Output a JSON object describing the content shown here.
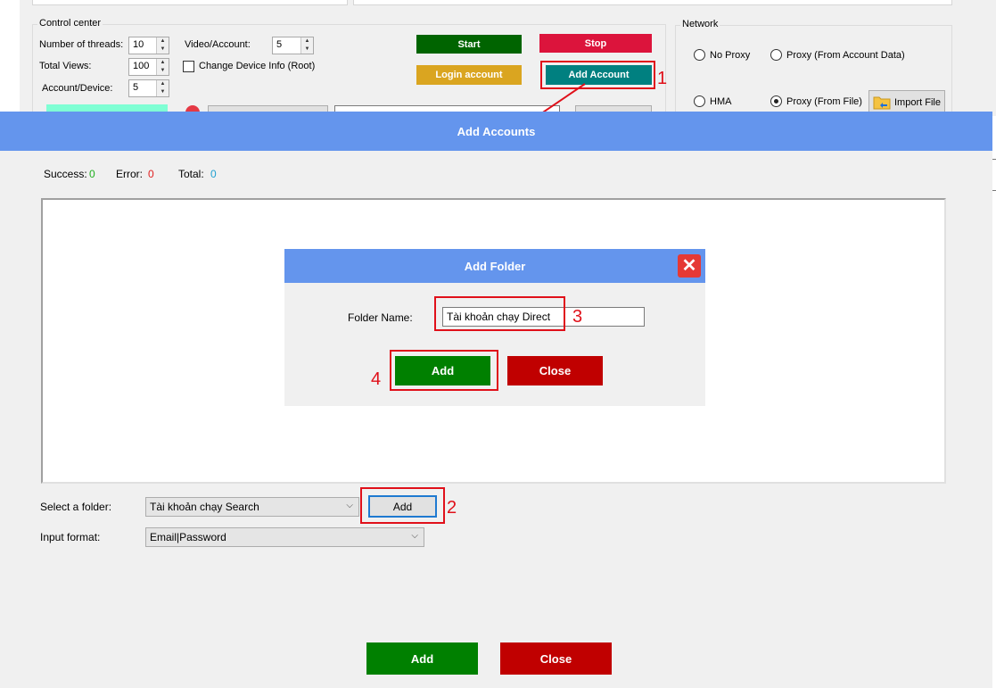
{
  "control_center": {
    "title": "Control center",
    "threads_label": "Number of threads:",
    "threads_value": "10",
    "total_views_label": "Total Views:",
    "total_views_value": "100",
    "account_device_label": "Account/Device:",
    "account_device_value": "5",
    "video_account_label": "Video/Account:",
    "video_account_value": "5",
    "change_device_label": "Change Device Info (Root)",
    "start_label": "Start",
    "stop_label": "Stop",
    "login_label": "Login account",
    "add_account_label": "Add Account"
  },
  "network": {
    "title": "Network",
    "no_proxy": "No Proxy",
    "proxy_account": "Proxy (From Account Data)",
    "hma": "HMA",
    "proxy_file": "Proxy (From File)",
    "import_file": "Import File"
  },
  "add_accounts": {
    "title": "Add Accounts",
    "success_label": "Success:",
    "success_value": "0",
    "error_label": "Error:",
    "error_value": "0",
    "total_label": "Total:",
    "total_value": "0",
    "select_folder_label": "Select a folder:",
    "selected_folder": "Tài khoản chạy Search",
    "add_folder_button": "Add",
    "input_format_label": "Input format:",
    "input_format_value": "Email|Password",
    "add_button": "Add",
    "close_button": "Close"
  },
  "add_folder": {
    "title": "Add Folder",
    "folder_name_label": "Folder Name:",
    "folder_name_value": "Tài khoản chạy Direct",
    "add_button": "Add",
    "close_button": "Close"
  },
  "steps": [
    "1",
    "2",
    "3",
    "4"
  ],
  "colors": {
    "header_blue": "#6495ed",
    "green": "#008000",
    "red": "#c00000",
    "stop_red": "#dc143c",
    "gold": "#daa520",
    "teal": "#008080",
    "annotation_red": "#e0101a"
  }
}
